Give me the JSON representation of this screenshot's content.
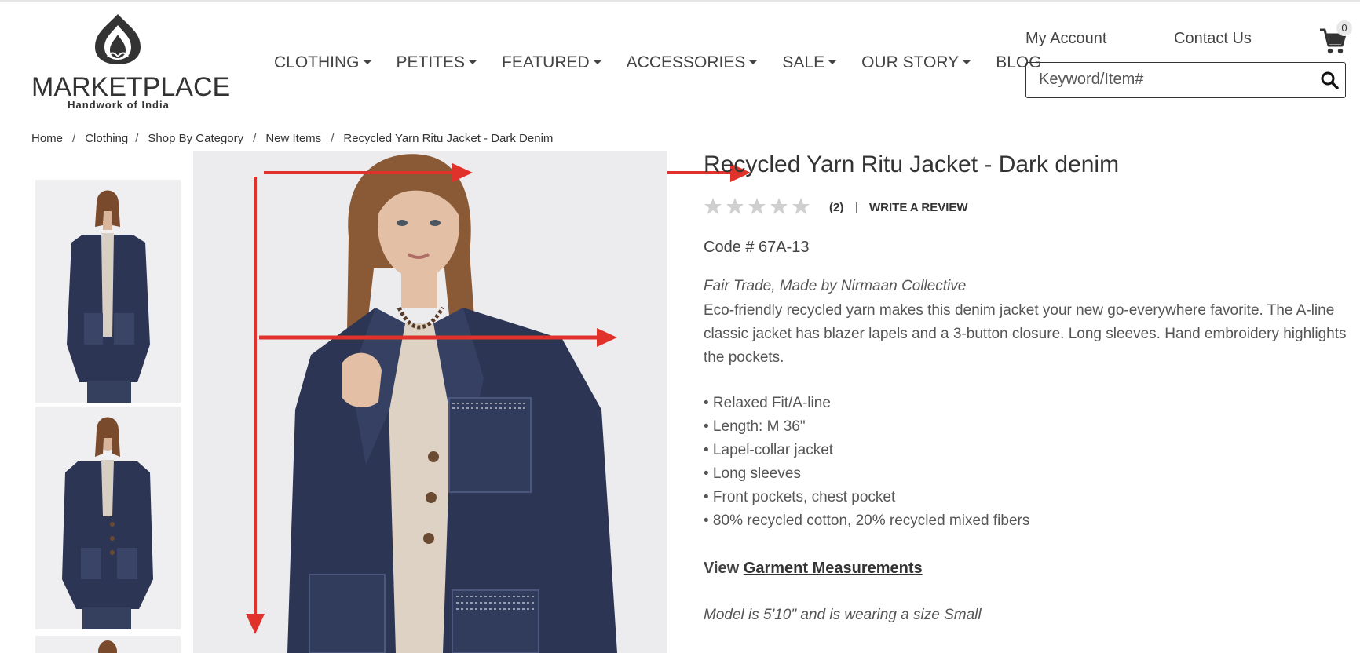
{
  "brand": {
    "name": "MARKETPLACE",
    "tagline": "Handwork of India"
  },
  "nav": [
    {
      "label": "CLOTHING",
      "dropdown": true
    },
    {
      "label": "PETITES",
      "dropdown": true
    },
    {
      "label": "FEATURED",
      "dropdown": true
    },
    {
      "label": "ACCESSORIES",
      "dropdown": true
    },
    {
      "label": "SALE",
      "dropdown": true
    },
    {
      "label": "OUR STORY",
      "dropdown": true
    },
    {
      "label": "BLOG",
      "dropdown": false
    }
  ],
  "header": {
    "my_account": "My Account",
    "contact_us": "Contact Us",
    "cart_count": "0",
    "search_placeholder": "Keyword/Item#"
  },
  "breadcrumb": [
    "Home",
    "Clothing",
    "Shop By Category",
    "New Items",
    "Recycled Yarn Ritu Jacket - Dark Denim"
  ],
  "product": {
    "title": "Recycled Yarn Ritu Jacket - Dark denim",
    "rating": 0,
    "review_count": "(2)",
    "review_sep": "|",
    "write_review": "WRITE A REVIEW",
    "code": "Code # 67A-13",
    "tagline": "Fair Trade, Made by Nirmaan Collective",
    "description": "Eco-friendly recycled yarn makes this denim jacket your new go-everywhere favorite. The A-line classic jacket has blazer lapels and a 3-button closure. Long sleeves. Hand embroidery highlights the pockets.",
    "features": [
      "• Relaxed Fit/A-line",
      "• Length: M 36\"",
      "• Lapel-collar jacket",
      "• Long sleeves",
      "• Front pockets, chest pocket",
      "• 80% recycled cotton, 20% recycled mixed fibers"
    ],
    "view_prefix": "View",
    "measurements_link": "Garment Measurements",
    "model_note": "Model is 5'10\" and is wearing a size Small"
  },
  "colors": {
    "text": "#444444",
    "annotation_arrow": "#e0322b",
    "jacket": "#2c3553",
    "star": "#cfcfcf"
  }
}
